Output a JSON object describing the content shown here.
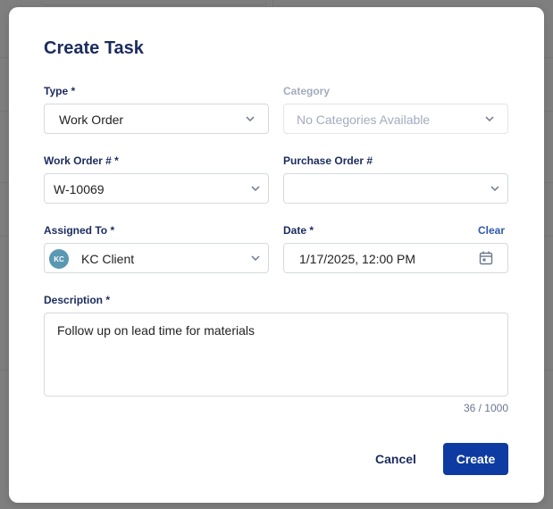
{
  "modal": {
    "title": "Create Task",
    "type": {
      "label": "Type *",
      "value": "Work Order"
    },
    "category": {
      "label": "Category",
      "placeholder": "No Categories Available"
    },
    "work_order": {
      "label": "Work Order # *",
      "value": "W-10069"
    },
    "purchase_order": {
      "label": "Purchase Order #",
      "value": ""
    },
    "assigned_to": {
      "label": "Assigned To *",
      "avatar_initials": "KC",
      "value": "KC Client"
    },
    "date": {
      "label": "Date *",
      "clear_label": "Clear",
      "value": "1/17/2025, 12:00 PM"
    },
    "description": {
      "label": "Description *",
      "value": "Follow up on lead time for materials",
      "counter": "36 / 1000"
    },
    "buttons": {
      "cancel": "Cancel",
      "create": "Create"
    }
  },
  "colors": {
    "primary": "#0d3ba1",
    "heading": "#1b2b5e",
    "avatar": "#5a98b2",
    "overlay": "#7f7f7f"
  },
  "icons": {
    "dropdown": "chevron-down-icon",
    "date": "calendar-icon"
  }
}
